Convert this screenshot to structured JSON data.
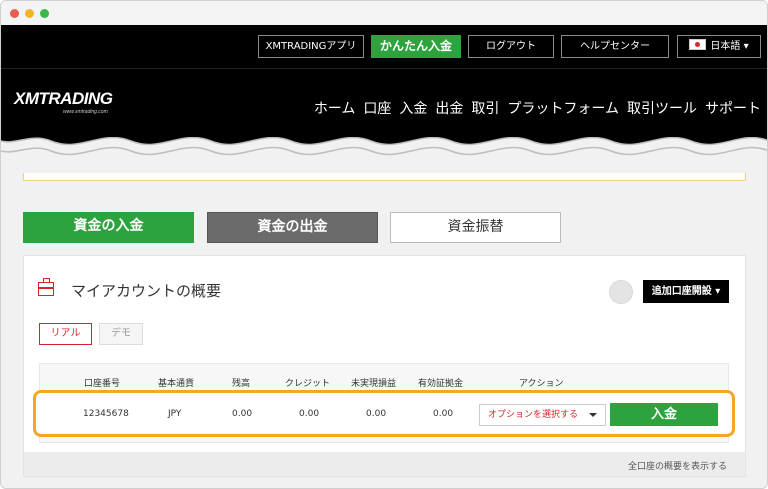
{
  "header": {
    "top_buttons": [
      "XMTRADINGアプリ",
      "かんたん入金",
      "ログアウト",
      "ヘルプセンター",
      "日本語 ▾"
    ],
    "logo_text": "XMTRADING",
    "logo_sub": "www.xmtrading.com",
    "nav": [
      "ホーム",
      "口座",
      "入金",
      "出金",
      "取引",
      "プラットフォーム",
      "取引ツール",
      "サポート"
    ]
  },
  "tabs": {
    "deposit": "資金の入金",
    "withdraw": "資金の出金",
    "transfer": "資金振替"
  },
  "panel": {
    "title": "マイアカウントの概要",
    "add_account": "追加口座開設 ▾",
    "pills": {
      "real": "リアル",
      "demo": "デモ"
    },
    "columns": [
      "口座番号",
      "基本通貨",
      "残高",
      "クレジット",
      "未実現損益",
      "有効証拠金",
      "アクション"
    ],
    "row": {
      "account": "12345678",
      "currency": "JPY",
      "balance": "0.00",
      "credit": "0.00",
      "unrealized": "0.00",
      "equity": "0.00",
      "select_placeholder": "オプションを選択する",
      "deposit_button": "入金"
    },
    "footer_link": "全口座の概要を表示する"
  },
  "colors": {
    "brand_green": "#2ca33f",
    "accent_red": "#d8232a",
    "highlight_orange": "#f5a623"
  }
}
